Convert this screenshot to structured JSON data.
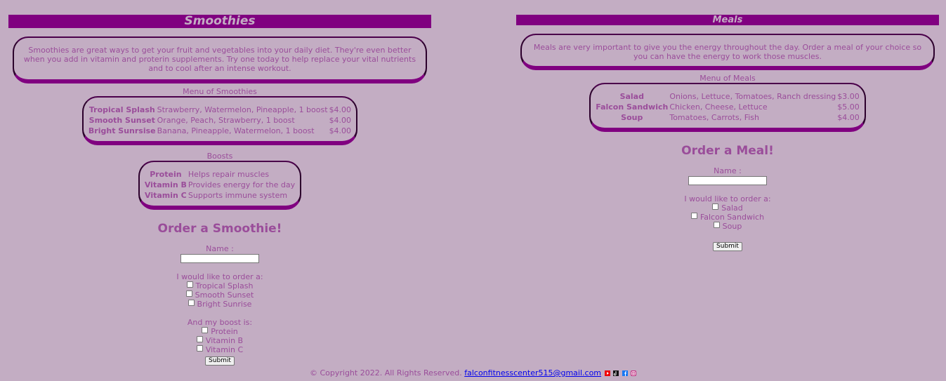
{
  "smoothies": {
    "title": "Smoothies",
    "intro": "Smoothies are great ways to get your fruit and vegetables into your daily diet. They're even better when you add in vitamin and proterin supplements. Try one today to help replace your vital nutrients and to cool after an intense workout.",
    "menu_title": "Menu of Smoothies",
    "menu": [
      {
        "name": "Tropical Splash",
        "desc": "Strawberry, Watermelon, Pineapple, 1 boost",
        "price": "$4.00"
      },
      {
        "name": "Smooth Sunset",
        "desc": "Orange, Peach, Strawberry, 1 boost",
        "price": "$4.00"
      },
      {
        "name": "Bright Sunrsise",
        "desc": "Banana, Pineapple, Watermelon, 1 boost",
        "price": "$4.00"
      }
    ],
    "boosts_title": "Boosts",
    "boosts": [
      {
        "name": "Protein",
        "desc": "Helps repair muscles"
      },
      {
        "name": "Vitamin B",
        "desc": "Provides energy for the day"
      },
      {
        "name": "Vitamin C",
        "desc": "Supports immune system"
      }
    ],
    "order_heading": "Order a Smoothie!",
    "name_label": "Name :",
    "order_label": "I would like to order a:",
    "options": [
      "Tropical Splash",
      "Smooth Sunset",
      "Bright Sunrise"
    ],
    "boost_label": "And my boost is:",
    "boost_options": [
      "Protein",
      "Vitamin B",
      "Vitamin C"
    ],
    "submit": "Submit"
  },
  "meals": {
    "title": "Meals",
    "intro": "Meals are very important to give you the energy throughout the day. Order a meal of your choice so you can have the energy to work those muscles.",
    "menu_title": "Menu of Meals",
    "menu": [
      {
        "name": "Salad",
        "desc": "Onions, Lettuce, Tomatoes, Ranch dressing",
        "price": "$3.00"
      },
      {
        "name": "Falcon Sandwich",
        "desc": "Chicken, Cheese, Lettuce",
        "price": "$5.00"
      },
      {
        "name": "Soup",
        "desc": "Tomatoes, Carrots, Fish",
        "price": "$4.00"
      }
    ],
    "order_heading": "Order a Meal!",
    "name_label": "Name :",
    "order_label": "I would like to order a:",
    "options": [
      "Salad",
      "Falcon Sandwich",
      "Soup"
    ],
    "submit": "Submit"
  },
  "footer": {
    "copyright": "© Copyright 2022. All Rights Reserved.",
    "email": "falconfitnesscenter515@gmail.com",
    "social_icons": [
      "youtube-icon",
      "tiktok-icon",
      "facebook-icon",
      "instagram-icon"
    ]
  },
  "colors": {
    "background": "#c3adc3",
    "accent": "#800080",
    "text": "#9a4d9a"
  }
}
